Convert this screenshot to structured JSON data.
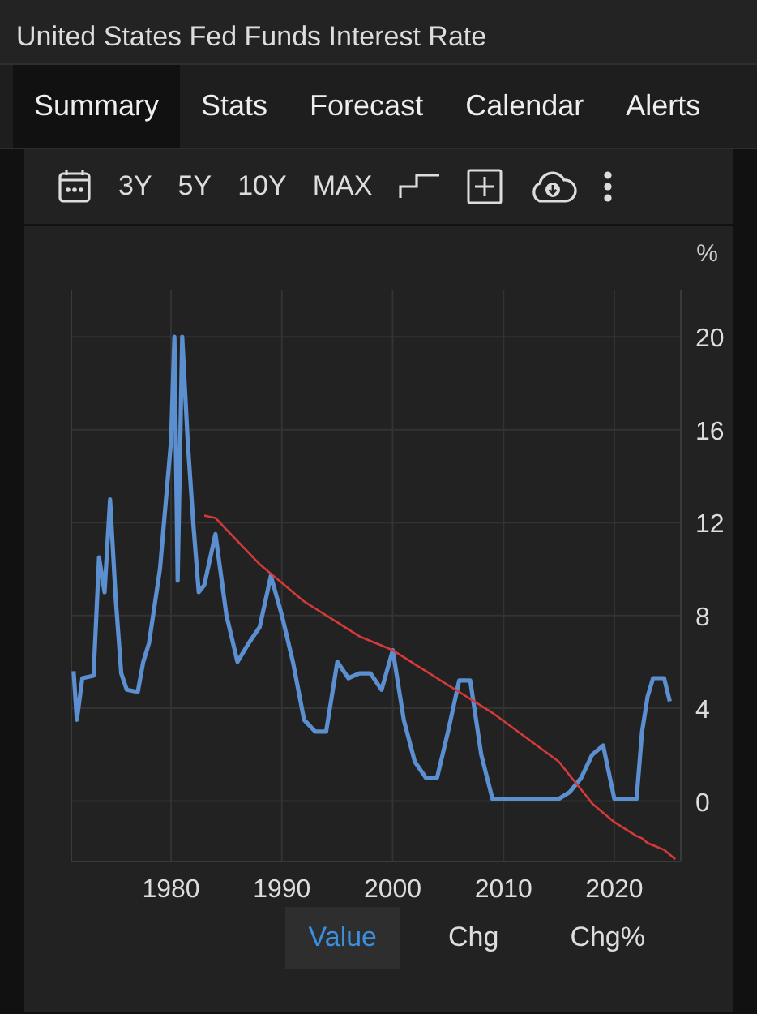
{
  "window": {
    "title": "United States Fed Funds Interest Rate"
  },
  "tabs": [
    {
      "label": "Summary",
      "selected": true
    },
    {
      "label": "Stats",
      "selected": false
    },
    {
      "label": "Forecast",
      "selected": false
    },
    {
      "label": "Calendar",
      "selected": false
    },
    {
      "label": "Alerts",
      "selected": false
    }
  ],
  "toolbar": {
    "ranges": [
      "3Y",
      "5Y",
      "10Y",
      "MAX"
    ]
  },
  "chart": {
    "unit": "%",
    "chart_data": {
      "type": "line",
      "x": [
        1971.2,
        1971.5,
        1972,
        1973,
        1973.5,
        1974,
        1974.5,
        1975,
        1975.5,
        1976,
        1977,
        1977.5,
        1978,
        1979,
        1980,
        1980.3,
        1980.6,
        1981,
        1981.5,
        1982,
        1982.5,
        1983,
        1984,
        1985,
        1986,
        1987,
        1988,
        1989,
        1990,
        1991,
        1992,
        1993,
        1994,
        1995,
        1996,
        1997,
        1998,
        1999,
        2000,
        2001,
        2002,
        2003,
        2004,
        2005,
        2006,
        2007,
        2008,
        2009,
        2015,
        2016,
        2017,
        2018,
        2019,
        2020,
        2022,
        2022.5,
        2023,
        2023.5,
        2024.5,
        2025,
        2025.5
      ],
      "series": [
        {
          "color": "#5b8fd0",
          "values": [
            5.6,
            3.5,
            5.3,
            5.4,
            10.5,
            9,
            13,
            8.8,
            5.5,
            4.8,
            4.7,
            6,
            6.8,
            10,
            15.5,
            20,
            9.5,
            20,
            15.5,
            12,
            9,
            9.3,
            11.5,
            8,
            6,
            6.8,
            7.5,
            9.7,
            8,
            6,
            3.5,
            3,
            3,
            6,
            5.3,
            5.5,
            5.5,
            4.8,
            6.5,
            3.5,
            1.7,
            1,
            1,
            3,
            5.2,
            5.2,
            2,
            0.1,
            0.1,
            0.4,
            1,
            2,
            2.4,
            0.1,
            0.1,
            3,
            4.5,
            5.3,
            5.3,
            4.3,
            null
          ]
        },
        {
          "color": "#d43a3a",
          "values": [
            null,
            null,
            null,
            null,
            null,
            null,
            null,
            null,
            null,
            null,
            null,
            null,
            null,
            null,
            null,
            null,
            null,
            null,
            null,
            null,
            null,
            12.3,
            12.2,
            11.7,
            11.2,
            10.7,
            10.2,
            9.8,
            9.4,
            9.0,
            8.6,
            8.3,
            8.0,
            7.7,
            7.4,
            7.1,
            6.9,
            6.7,
            6.5,
            6.2,
            5.9,
            5.6,
            5.3,
            5.0,
            4.7,
            4.4,
            4.1,
            3.8,
            1.7,
            1.1,
            0.5,
            -0.1,
            -0.5,
            -0.9,
            -1.5,
            -1.6,
            -1.8,
            -1.9,
            -2.1,
            -2.3,
            -2.5
          ]
        }
      ],
      "xlim": [
        1971,
        2026
      ],
      "ylim": [
        -2.6,
        22
      ],
      "grid": true,
      "xticks": [
        1980,
        1990,
        2000,
        2010,
        2020
      ],
      "yticks": [
        0,
        4,
        8,
        12,
        16,
        20
      ]
    }
  },
  "modes": [
    {
      "label": "Value",
      "selected": true
    },
    {
      "label": "Chg",
      "selected": false
    },
    {
      "label": "Chg%",
      "selected": false
    }
  ]
}
